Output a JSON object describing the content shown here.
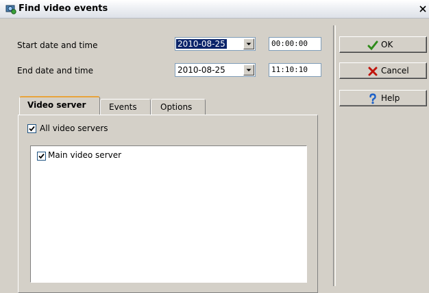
{
  "window": {
    "title": "Find video events",
    "close_glyph": "×"
  },
  "form": {
    "start_label": "Start date and time",
    "end_label": "End date and time",
    "start_date": "2010-08-25",
    "start_time": "00:00:00",
    "end_date": "2010-08-25",
    "end_time": "11:10:10"
  },
  "buttons": {
    "ok": {
      "label": "OK",
      "icon": "checkmark-icon",
      "color": "#2e8b1a"
    },
    "cancel": {
      "label": "Cancel",
      "icon": "x-icon",
      "color": "#c0140c"
    },
    "help": {
      "label": "Help",
      "icon": "question-icon",
      "color": "#1a5fc8"
    }
  },
  "tabs": [
    {
      "label": "Video server",
      "active": true
    },
    {
      "label": "Events",
      "active": false
    },
    {
      "label": "Options",
      "active": false
    }
  ],
  "video_server": {
    "all_label": "All video servers",
    "all_checked": true,
    "servers": [
      {
        "label": "Main video server",
        "checked": true
      }
    ]
  },
  "colors": {
    "selection": "#0a246a",
    "tab_highlight": "#e8a33c",
    "face": "#d4d0c8"
  }
}
